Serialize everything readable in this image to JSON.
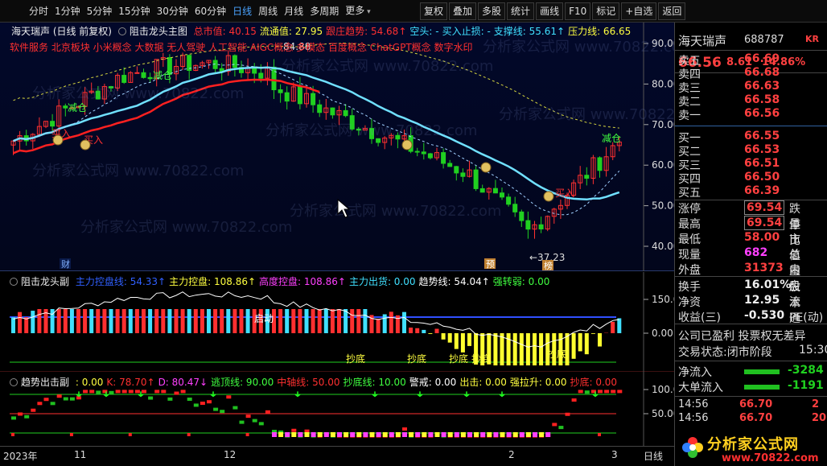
{
  "toolbar": {
    "periods": [
      "分时",
      "1分钟",
      "5分钟",
      "15分钟",
      "30分钟",
      "60分钟",
      "日线",
      "周线",
      "月线",
      "多周期",
      "更多"
    ],
    "active": "日线",
    "buttons": [
      "复权",
      "叠加",
      "多股",
      "统计",
      "画线",
      "F10",
      "标记",
      "+自选",
      "返回"
    ]
  },
  "main": {
    "stock_label": "海天瑞声 (日线 前复权)",
    "indicator_name": "阻击龙头主图",
    "legend": [
      {
        "label": "总市值: 40.15",
        "color": "#ff3030"
      },
      {
        "label": "流通值: 27.95",
        "color": "#ffff40"
      },
      {
        "label": "跟庄趋势: 54.68↑",
        "color": "#ff3030"
      },
      {
        "label": "空头: -",
        "color": "#40e0ff"
      },
      {
        "label": "买入止损: -",
        "color": "#40e0ff"
      },
      {
        "label": "支撑线: 55.61↑",
        "color": "#40e0ff"
      },
      {
        "label": "压力线: 66.65",
        "color": "#ffff40"
      }
    ],
    "concepts": "软件服务 北京板块 小米概念 大数据 无人驾驶 人工智能 AIGC概念 多模态 百度概念 ChatGPT概念 数字水印",
    "high_label": "84.88",
    "low_label": "←37.23",
    "y_ticks": [
      "90.00",
      "80.00",
      "70.00",
      "60.00",
      "50.00",
      "40.00"
    ],
    "signals": [
      {
        "text": "减仓",
        "color": "#40ff40"
      },
      {
        "text": "减仓",
        "color": "#40ff40"
      },
      {
        "text": "买入",
        "color": "#ff3030"
      },
      {
        "text": "买入",
        "color": "#ff3030"
      },
      {
        "text": "买入",
        "color": "#ff3030"
      },
      {
        "text": "减仓",
        "color": "#40ff40"
      }
    ],
    "markers": [
      "财",
      "预",
      "榜"
    ]
  },
  "sub1": {
    "name": "阻击龙头副",
    "legend": [
      {
        "label": "主力控盘线: 54.33↑",
        "color": "#3060ff"
      },
      {
        "label": "主力控盘: 108.86↑",
        "color": "#ffff40"
      },
      {
        "label": "高度控盘: 108.86↑",
        "color": "#ff40ff"
      },
      {
        "label": "主力出货: 0.00",
        "color": "#40e0ff"
      },
      {
        "label": "趋势线: 54.04↑",
        "color": "#ffffff"
      },
      {
        "label": "强转弱: 0.00",
        "color": "#40ff40"
      }
    ],
    "y_ticks": [
      "150.0",
      "0.00"
    ],
    "labels": [
      "启动",
      "抄底",
      "抄底",
      "抄底",
      "抄底",
      "抄底"
    ]
  },
  "sub2": {
    "name": "趋势出击副",
    "legend": [
      {
        "label": ": 0.00",
        "color": "#ffff40"
      },
      {
        "label": "K: 78.70↑",
        "color": "#ff3030"
      },
      {
        "label": "D: 80.47↓",
        "color": "#ff40ff"
      },
      {
        "label": "逃顶线: 90.00",
        "color": "#40ff40"
      },
      {
        "label": "中轴线: 50.00",
        "color": "#ff3030"
      },
      {
        "label": "抄底线: 10.00",
        "color": "#40ff40"
      },
      {
        "label": "警戒: 0.00",
        "color": "#ffffff"
      },
      {
        "label": "出击: 0.00",
        "color": "#ffff40"
      },
      {
        "label": "强拉升: 0.00",
        "color": "#ffff40"
      },
      {
        "label": "抄底: 0.00",
        "color": "#ff3030"
      }
    ],
    "y_ticks": [
      "100.0",
      "50.00"
    ]
  },
  "xaxis": [
    "2023年",
    "11",
    "12",
    "2",
    "3",
    "日线"
  ],
  "quote": {
    "name": "海天瑞声",
    "code": "688787",
    "tag": "KR",
    "price": "66.56",
    "change": "8.61",
    "pct": "14.86%",
    "asks": [
      {
        "label": "卖五",
        "price": "66.69"
      },
      {
        "label": "卖四",
        "price": "66.68"
      },
      {
        "label": "卖三",
        "price": "66.63"
      },
      {
        "label": "卖二",
        "price": "66.58"
      },
      {
        "label": "卖一",
        "price": "66.56"
      }
    ],
    "bids": [
      {
        "label": "买一",
        "price": "66.55"
      },
      {
        "label": "买二",
        "price": "66.53"
      },
      {
        "label": "买三",
        "price": "66.51"
      },
      {
        "label": "买四",
        "price": "66.50"
      },
      {
        "label": "买五",
        "price": "66.39"
      }
    ],
    "stats": [
      {
        "l1": "涨停",
        "v1": "69.54",
        "l2": "跌停"
      },
      {
        "l1": "最高",
        "v1": "69.54",
        "l2": "量比"
      },
      {
        "l1": "最低",
        "v1": "58.00",
        "l2": "市值"
      },
      {
        "l1": "现量",
        "v1": "682",
        "l2": "总量"
      },
      {
        "l1": "外盘",
        "v1": "31373",
        "l2": "内盘"
      }
    ],
    "fin": [
      {
        "l1": "换手",
        "v1": "16.01%",
        "l2": "股本"
      },
      {
        "l1": "净资",
        "v1": "12.95",
        "l2": "流通"
      },
      {
        "l1": "收益(三)",
        "v1": "-0.530",
        "l2": "PE(动)"
      }
    ],
    "info1": "公司已盈利 投票权无差异",
    "info2_label": "交易状态:",
    "info2_value": "闭市阶段",
    "info2_time": "15:30",
    "flows": [
      {
        "label": "净流入",
        "value": "-3284"
      },
      {
        "label": "大单流入",
        "value": "-1191"
      }
    ],
    "ticks": [
      {
        "time": "14:56",
        "price": "66.70",
        "vol": "2"
      },
      {
        "time": "14:56",
        "price": "66.70",
        "vol": "20"
      }
    ],
    "watermark": "分析家公式网",
    "watermark_url": "www.70822.com"
  },
  "watermark_text": "分析家公式网 www.70822.com"
}
